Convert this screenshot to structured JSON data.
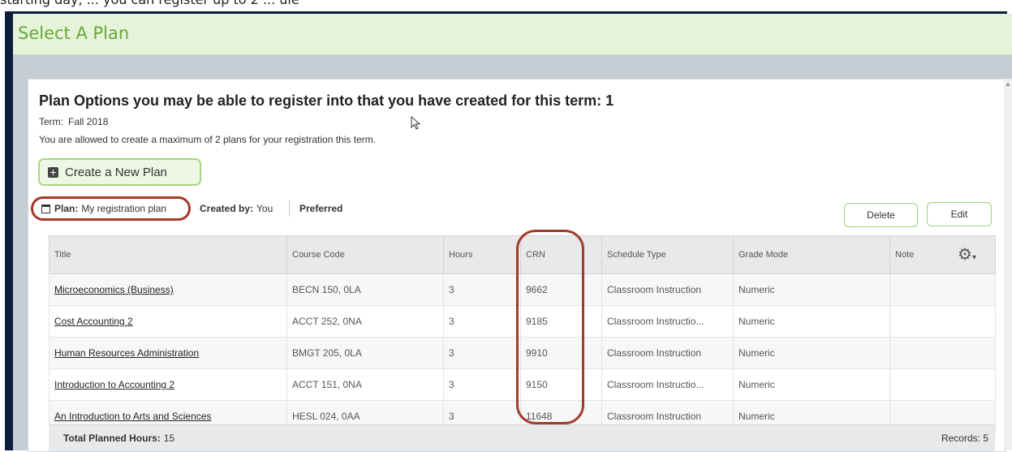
{
  "top_fragment": "starting day, ... you can register up to 2 ... ule",
  "header": {
    "title": "Select A Plan"
  },
  "panel": {
    "heading": "Plan Options you may be able to register into that you have created for this term: 1",
    "term_label": "Term:",
    "term_value": "Fall 2018",
    "allowed_text": "You are allowed to create a maximum of 2 plans for your registration this term.",
    "create_button": "Create a New Plan"
  },
  "plan": {
    "plan_label": "Plan:",
    "plan_name": "My registration plan",
    "created_label": "Created by:",
    "created_value": "You",
    "preferred": "Preferred",
    "delete_button": "Delete",
    "edit_button": "Edit"
  },
  "table": {
    "columns": [
      "Title",
      "Course Code",
      "Hours",
      "CRN",
      "Schedule Type",
      "Grade Mode",
      "Note"
    ],
    "rows": [
      [
        "Microeconomics (Business)",
        "BECN 150, 0LA",
        "3",
        "9662",
        "Classroom Instruction",
        "Numeric",
        ""
      ],
      [
        "Cost Accounting 2",
        "ACCT 252, 0NA",
        "3",
        "9185",
        "Classroom Instructio...",
        "Numeric",
        ""
      ],
      [
        "Human Resources Administration",
        "BMGT 205, 0LA",
        "3",
        "9910",
        "Classroom Instruction",
        "Numeric",
        ""
      ],
      [
        "Introduction to Accounting 2",
        "ACCT 151, 0NA",
        "3",
        "9150",
        "Classroom Instructio...",
        "Numeric",
        ""
      ],
      [
        "An Introduction to Arts and Sciences",
        "HESL 024, 0AA",
        "3",
        "11648",
        "Classroom Instruction",
        "Numeric",
        ""
      ]
    ]
  },
  "footer": {
    "total_label": "Total Planned Hours:",
    "total_value": "15",
    "records": "Records: 5"
  },
  "icons": {
    "gear": "gear-icon",
    "plus": "plus-square-icon",
    "calendar": "calendar-icon",
    "cursor": "mouse-cursor-icon"
  },
  "colors": {
    "accent_green": "#68a83a",
    "header_bg": "#e5f3d9",
    "annotation_red": "#a33b2c",
    "frame_navy": "#0b1d3a"
  }
}
